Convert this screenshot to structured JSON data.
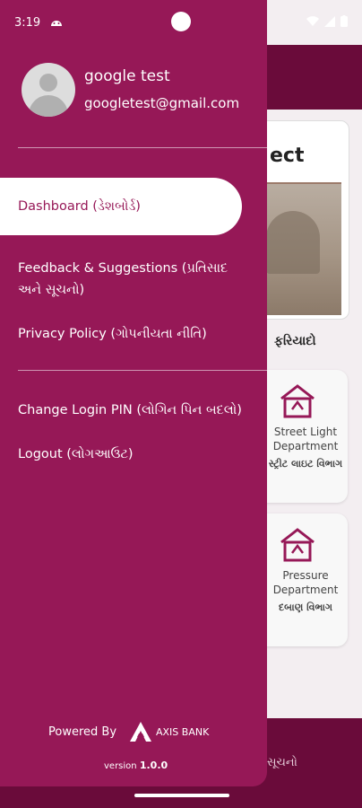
{
  "status": {
    "time": "3:19"
  },
  "drawer": {
    "user_name": "google test",
    "user_email": "googletest@gmail.com",
    "nav": {
      "dashboard": "Dashboard (ડેશબોર્ડ)",
      "feedback_line1": "Feedback & Suggestions (પ્રતિસાદ",
      "feedback_line2": "અને સૂચનો)",
      "privacy": "Privacy Policy (ગોપનીયતા નીતિ)",
      "change_pin": "Change Login PIN (લોગિન પિન બદલો)",
      "logout": "Logout (લોગઆઉટ)"
    },
    "powered_by": "Powered By",
    "bank_name": "AXIS BANK",
    "version_label": "version",
    "version_number": "1.0.0"
  },
  "background": {
    "card_title": "ect",
    "section_heading": "ફરિયાદો",
    "tiles": [
      {
        "line1": "Street Light",
        "line2": "Department",
        "line3": "સ્ટ્રીટ લાઇટ વિભાગ"
      },
      {
        "line1": "Pressure",
        "line2": "Department",
        "line3": "દબાણ વિભાગ"
      }
    ],
    "bottom_label": "સૂચનો"
  },
  "colors": {
    "drawer": "#961857",
    "appbar": "#6a0b3a",
    "active_text": "#961857"
  }
}
